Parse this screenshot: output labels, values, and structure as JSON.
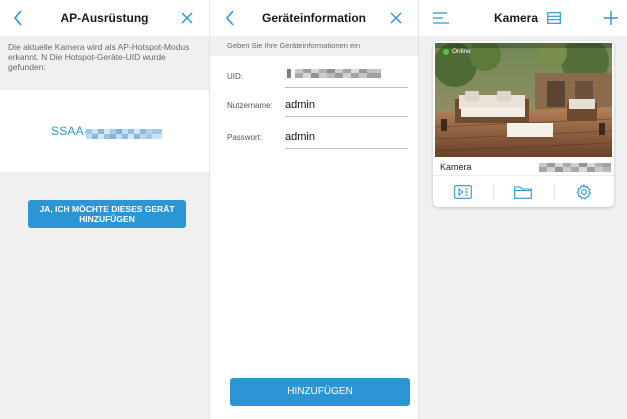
{
  "colors": {
    "accent": "#2b96d3",
    "online": "#3fcf3f"
  },
  "ap_screen": {
    "title": "AP-Ausrüstung",
    "back_icon": "chevron-left-icon",
    "close_icon": "close-icon",
    "info_text": "Die aktuelle Kamera wird als AP-Hotspot-Modus erkannt.  N Die Hotspot-Geräte-UID wurde gefunden:",
    "uid_prefix": "SSAA-",
    "add_button_label": "JA, ICH MÖCHTE DIESES GERÄT HINZUFÜGEN"
  },
  "device_info_screen": {
    "title": "Geräteinformation",
    "back_icon": "chevron-left-icon",
    "close_icon": "close-icon",
    "subtitle": "Geben Sie Ihre Geräteinformationen ein",
    "fields": [
      {
        "label": "UID:",
        "value": ""
      },
      {
        "label": "Nutzername:",
        "value": "admin"
      },
      {
        "label": "Passwort:",
        "value": "admin"
      }
    ],
    "submit_label": "HINZUFÜGEN"
  },
  "camera_list_screen": {
    "title": "Kamera",
    "menu_icon": "menu-icon",
    "title_icon": "layout-icon",
    "add_icon": "plus-icon",
    "camera": {
      "status": "Online",
      "name": "Kamera",
      "actions": [
        "playback-icon",
        "folder-icon",
        "settings-icon"
      ]
    }
  }
}
